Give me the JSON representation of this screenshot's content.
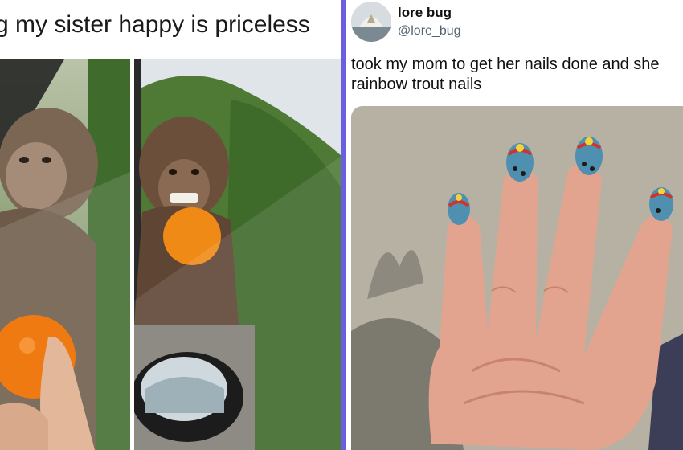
{
  "left_meme": {
    "caption": "g my sister happy is priceless"
  },
  "tweet": {
    "display_name": "lore bug",
    "handle": "@lore_bug",
    "text_line_1": "took my mom to get her nails done and she",
    "text_line_2": "rainbow trout nails"
  },
  "colors": {
    "divider": "#6b5fe0",
    "name_text": "#111111",
    "handle_text": "#536471"
  }
}
